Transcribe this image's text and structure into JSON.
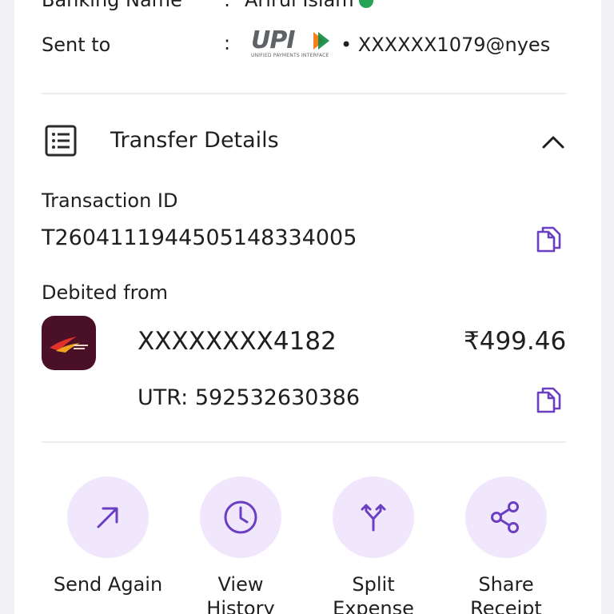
{
  "details": {
    "banking_name_label": "Banking Name",
    "colon": ":",
    "banking_name_value": "Arirul Islam",
    "sent_to_label": "Sent to",
    "upi_logo_text": "UPI",
    "upi_logo_subtitle": "UNIFIED PAYMENTS INTERFACE",
    "upi_id": "• XXXXXX1079@nyes"
  },
  "transfer": {
    "section_title": "Transfer Details",
    "transaction_id_label": "Transaction ID",
    "transaction_id_value": "T2604111944505148334005",
    "debited_from_label": "Debited from",
    "account_number": "XXXXXXXX4182",
    "amount": "₹499.46",
    "utr": "UTR: 592532630386"
  },
  "actions": [
    {
      "label": "Send Again",
      "icon": "arrow-up-right-icon"
    },
    {
      "label": "View History",
      "icon": "clock-icon"
    },
    {
      "label": "Split Expense",
      "icon": "split-icon"
    },
    {
      "label": "Share Receipt",
      "icon": "share-icon"
    }
  ],
  "colors": {
    "accent": "#6a3fc1",
    "accent_light": "#f1e7fd",
    "verified": "#23a455",
    "bank_logo_bg": "#4a1027"
  }
}
